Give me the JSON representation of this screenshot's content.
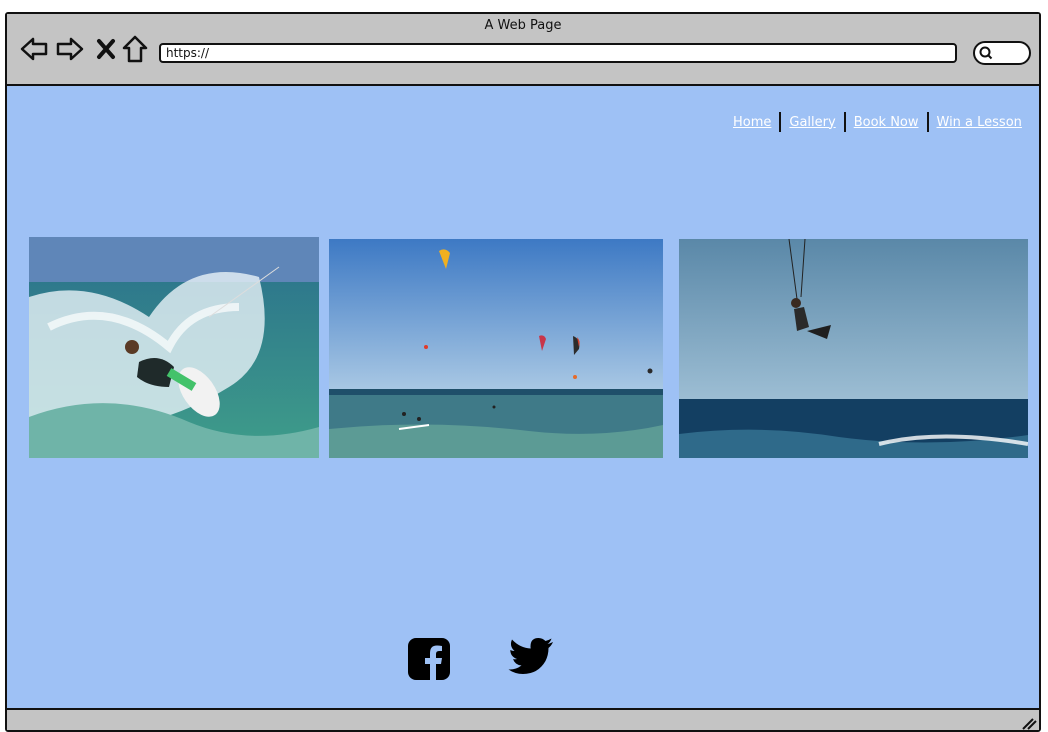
{
  "browser": {
    "title": "A Web Page",
    "url": "https://",
    "icons": [
      "back-arrow-icon",
      "forward-arrow-icon",
      "close-icon",
      "home-icon",
      "search-icon"
    ]
  },
  "nav": {
    "items": [
      {
        "label": "Home"
      },
      {
        "label": "Gallery"
      },
      {
        "label": "Book Now"
      },
      {
        "label": "Win a Lesson"
      }
    ]
  },
  "gallery": {
    "photos": [
      {
        "name": "kitesurfer-carving-wave"
      },
      {
        "name": "kites-over-ocean"
      },
      {
        "name": "kitesurfer-jumping"
      }
    ]
  },
  "social": {
    "icons": [
      "facebook-icon",
      "twitter-icon"
    ]
  },
  "colors": {
    "page_background": "#9ec1f5",
    "chrome": "#c4c4c4",
    "link": "#ffffff"
  }
}
